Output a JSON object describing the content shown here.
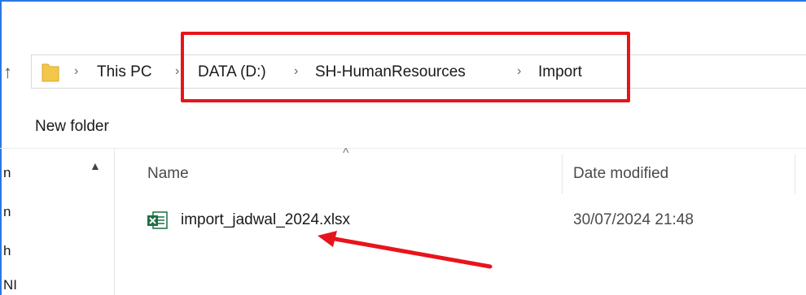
{
  "breadcrumb": {
    "items": [
      "This PC",
      "DATA (D:)",
      "SH-HumanResources",
      "Import"
    ],
    "separator": ">"
  },
  "toolbar": {
    "new_folder_label": "New folder"
  },
  "columns": {
    "name": "Name",
    "date_modified": "Date modified"
  },
  "files": [
    {
      "name": "import_jadwal_2024.xlsx",
      "date_modified": "30/07/2024 21:48",
      "icon": "excel-icon"
    }
  ],
  "nav_fragments": [
    "n",
    "n",
    "h",
    "NI"
  ],
  "colors": {
    "highlight": "#e8141b",
    "annotation_arrow": "#e8141b",
    "window_border": "#2b78e4",
    "excel_green": "#1d6f42",
    "folder_yellow": "#f3c84a"
  }
}
